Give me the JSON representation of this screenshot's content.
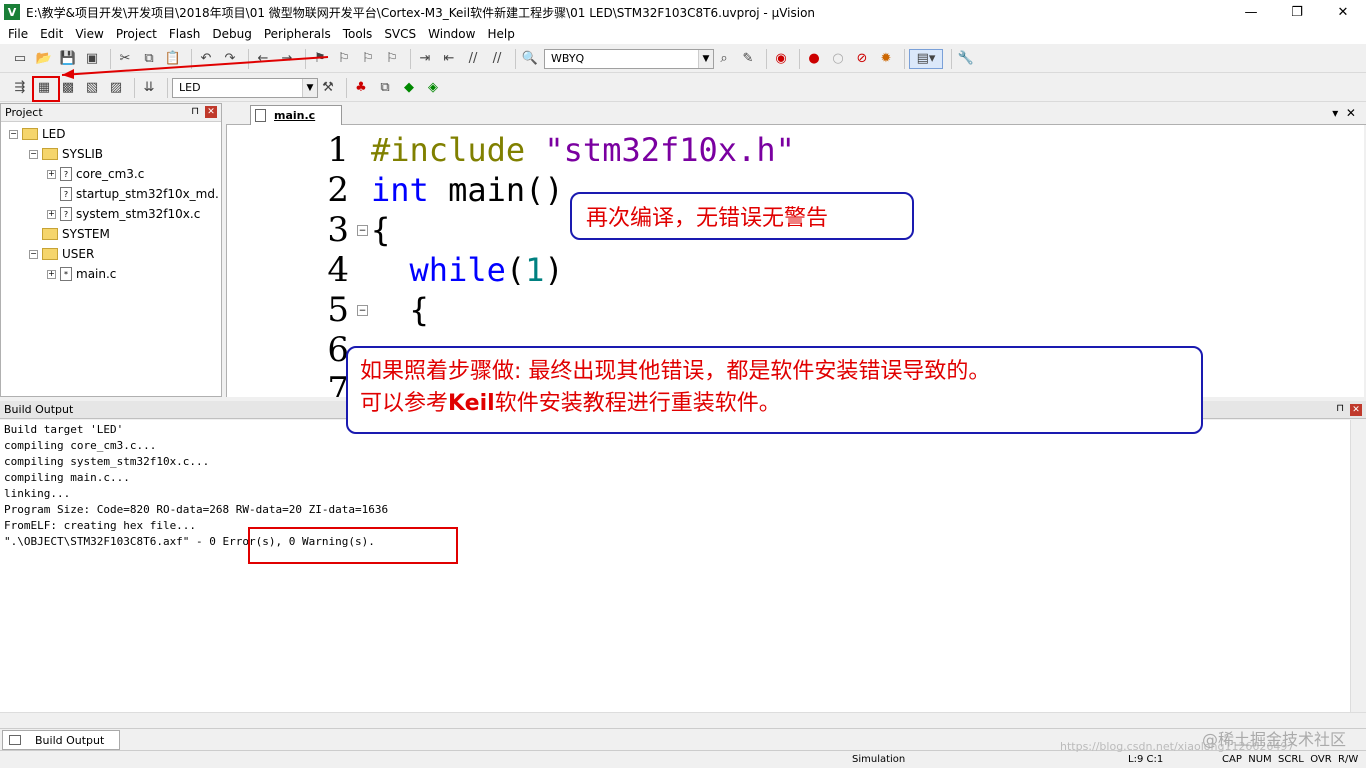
{
  "titlebar": {
    "title": "E:\\教学&项目开发\\开发项目\\2018年项目\\01 微型物联网开发平台\\Cortex-M3_Keil软件新建工程步骤\\01 LED\\STM32F103C8T6.uvproj - µVision",
    "app_icon": "V",
    "minimize": "—",
    "maximize": "❐",
    "close": "✕"
  },
  "menu": [
    "File",
    "Edit",
    "View",
    "Project",
    "Flash",
    "Debug",
    "Peripherals",
    "Tools",
    "SVCS",
    "Window",
    "Help"
  ],
  "toolbar1": {
    "find_combo": "WBYQ"
  },
  "toolbar2": {
    "target_combo": "LED"
  },
  "project_panel": {
    "title": "Project",
    "pin": "⊓",
    "close": "✕",
    "tree": [
      {
        "label": "LED"
      },
      {
        "label": "SYSLIB"
      },
      {
        "label": "core_cm3.c"
      },
      {
        "label": "startup_stm32f10x_md."
      },
      {
        "label": "system_stm32f10x.c"
      },
      {
        "label": "SYSTEM"
      },
      {
        "label": "USER"
      },
      {
        "label": "main.c"
      }
    ]
  },
  "editor": {
    "tab": "main.c",
    "line_numbers": [
      "1",
      "2",
      "3",
      "4",
      "5",
      "6",
      "7"
    ],
    "lines": [
      {
        "pp": "#include",
        "str": " \"stm32f10x.h\""
      },
      {
        "kw": "int",
        "rest": " main()"
      },
      {
        "text": "{"
      },
      {
        "kw": "  while",
        "rest1": "(",
        "num": "1",
        "rest2": ")"
      },
      {
        "text": "  {"
      }
    ]
  },
  "build_output": {
    "title": "Build Output",
    "lines": [
      "Build target 'LED'",
      "compiling core_cm3.c...",
      "compiling system_stm32f10x.c...",
      "compiling main.c...",
      "linking...",
      "Program Size: Code=820 RO-data=268 RW-data=20 ZI-data=1636",
      "FromELF: creating hex file...",
      "\".\\OBJECT\\STM32F103C8T6.axf\" - 0 Error(s), 0 Warning(s)."
    ],
    "tab": "Build Output"
  },
  "statusbar": {
    "mode": "Simulation",
    "pos": "L:9 C:1",
    "flags": "CAP  NUM  SCRL  OVR  R/W"
  },
  "annotations": {
    "callout1": "再次编译，无错误无警告",
    "callout2_line1": "如果照着步骤做: 最终出现其他错误，都是软件安装错误导致的。",
    "callout2_line2_a": "可以参考",
    "callout2_line2_b": "Keil",
    "callout2_line2_c": "软件安装教程进行重装软件。"
  },
  "watermark": "@稀土掘金技术社区",
  "watermark_url": "https://blog.csdn.net/xiaolong1126626497",
  "colors": {
    "annotation_red": "#e00000",
    "callout_border": "#1a1ab0",
    "keyword_blue": "#0000ff"
  }
}
